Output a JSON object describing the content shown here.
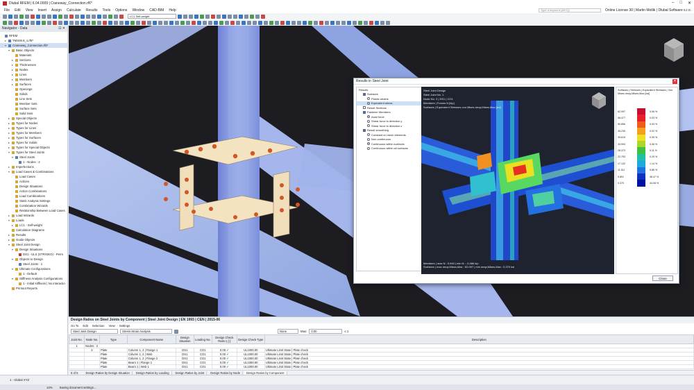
{
  "window": {
    "title": "Dlubal RFEM | 6.04.0009 | Craneway_Connection.rf6*"
  },
  "menu": [
    "File",
    "Edit",
    "View",
    "Insert",
    "Assign",
    "Calculate",
    "Results",
    "Tools",
    "Options",
    "Window",
    "CAD-BIM",
    "Help"
  ],
  "menu_right": {
    "search_placeholder": "Type a keyword (Alt+Q)",
    "license": "Online License 30 | Martin Motlik | Dlubal Software s.r.o."
  },
  "toolbar": {
    "load_case_code": "LC1",
    "load_case_name": "Self-weight"
  },
  "navigator": {
    "title": "Navigator - Data",
    "items": [
      {
        "label": "RFEM",
        "level": 0,
        "icon": "blue",
        "exp": ""
      },
      {
        "label": "TMS06.9_1.rf6*",
        "level": 1,
        "icon": "blue",
        "exp": "▸"
      },
      {
        "label": "Craneway_Connection.rf6*",
        "level": 1,
        "icon": "blue",
        "exp": "▾",
        "sel": true
      },
      {
        "label": "Basic Objects",
        "level": 2,
        "icon": "",
        "exp": "▾"
      },
      {
        "label": "Materials",
        "level": 3,
        "icon": "",
        "exp": ""
      },
      {
        "label": "Sections",
        "level": 3,
        "icon": "",
        "exp": "▸"
      },
      {
        "label": "Thicknesses",
        "level": 3,
        "icon": "",
        "exp": "▸"
      },
      {
        "label": "Nodes",
        "level": 3,
        "icon": "",
        "exp": "▸"
      },
      {
        "label": "Lines",
        "level": 3,
        "icon": "",
        "exp": "▸"
      },
      {
        "label": "Members",
        "level": 3,
        "icon": "",
        "exp": "▸"
      },
      {
        "label": "Surfaces",
        "level": 3,
        "icon": "",
        "exp": "▸"
      },
      {
        "label": "Openings",
        "level": 3,
        "icon": "",
        "exp": ""
      },
      {
        "label": "Solids",
        "level": 3,
        "icon": "",
        "exp": ""
      },
      {
        "label": "Line Sets",
        "level": 3,
        "icon": "",
        "exp": ""
      },
      {
        "label": "Member Sets",
        "level": 3,
        "icon": "",
        "exp": ""
      },
      {
        "label": "Surface Sets",
        "level": 3,
        "icon": "",
        "exp": ""
      },
      {
        "label": "Solid Sets",
        "level": 3,
        "icon": "",
        "exp": ""
      },
      {
        "label": "Special Objects",
        "level": 2,
        "icon": "",
        "exp": "▸"
      },
      {
        "label": "Types for Nodes",
        "level": 2,
        "icon": "",
        "exp": "▸"
      },
      {
        "label": "Types for Lines",
        "level": 2,
        "icon": "",
        "exp": "▸"
      },
      {
        "label": "Types for Members",
        "level": 2,
        "icon": "",
        "exp": "▸"
      },
      {
        "label": "Types for Surfaces",
        "level": 2,
        "icon": "",
        "exp": "▸"
      },
      {
        "label": "Types for Solids",
        "level": 2,
        "icon": "",
        "exp": "▸"
      },
      {
        "label": "Types for Special Objects",
        "level": 2,
        "icon": "",
        "exp": "▸"
      },
      {
        "label": "Types for Steel Joints",
        "level": 2,
        "icon": "",
        "exp": "▾"
      },
      {
        "label": "Steel Joints",
        "level": 3,
        "icon": "blue",
        "exp": "▾"
      },
      {
        "label": "1 - Nodes : 2",
        "level": 4,
        "icon": "blue",
        "exp": ""
      },
      {
        "label": "Imperfections",
        "level": 2,
        "icon": "",
        "exp": "▸"
      },
      {
        "label": "Load Cases & Combinations",
        "level": 2,
        "icon": "",
        "exp": "▾"
      },
      {
        "label": "Load Cases",
        "level": 3,
        "icon": "",
        "exp": ""
      },
      {
        "label": "Actions",
        "level": 3,
        "icon": "",
        "exp": ""
      },
      {
        "label": "Design Situations",
        "level": 3,
        "icon": "",
        "exp": ""
      },
      {
        "label": "Action Combinations",
        "level": 3,
        "icon": "",
        "exp": ""
      },
      {
        "label": "Load Combinations",
        "level": 3,
        "icon": "",
        "exp": ""
      },
      {
        "label": "Static Analysis Settings",
        "level": 3,
        "icon": "",
        "exp": ""
      },
      {
        "label": "Combination Wizards",
        "level": 3,
        "icon": "",
        "exp": ""
      },
      {
        "label": "Relationship Between Load Cases",
        "level": 3,
        "icon": "",
        "exp": ""
      },
      {
        "label": "Load Wizards",
        "level": 2,
        "icon": "",
        "exp": "▸"
      },
      {
        "label": "Loads",
        "level": 2,
        "icon": "",
        "exp": "▾"
      },
      {
        "label": "LC1 - Self-weight",
        "level": 3,
        "icon": "",
        "exp": "▸"
      },
      {
        "label": "Calculation Diagrams",
        "level": 2,
        "icon": "",
        "exp": ""
      },
      {
        "label": "Results",
        "level": 2,
        "icon": "",
        "exp": "▸"
      },
      {
        "label": "Guide Objects",
        "level": 2,
        "icon": "",
        "exp": "▸"
      },
      {
        "label": "Steel Joint Design",
        "level": 2,
        "icon": "",
        "exp": "▾"
      },
      {
        "label": "Design Situations",
        "level": 3,
        "icon": "",
        "exp": "▾"
      },
      {
        "label": "DS1 - ULS (STR/GEO) - Perm",
        "level": 4,
        "icon": "red",
        "exp": ""
      },
      {
        "label": "Objects to Design",
        "level": 3,
        "icon": "",
        "exp": "▾"
      },
      {
        "label": "Steel Joints : 1",
        "level": 4,
        "icon": "blue",
        "exp": ""
      },
      {
        "label": "Ultimate Configurations",
        "level": 3,
        "icon": "",
        "exp": "▾"
      },
      {
        "label": "1 - Default",
        "level": 4,
        "icon": "",
        "exp": ""
      },
      {
        "label": "Stiffness Analysis Configurations",
        "level": 3,
        "icon": "",
        "exp": "▾"
      },
      {
        "label": "1 - Initial stiffness | No interactio",
        "level": 4,
        "icon": "",
        "exp": ""
      },
      {
        "label": "Printout Reports",
        "level": 2,
        "icon": "",
        "exp": ""
      }
    ]
  },
  "dialog": {
    "title": "Results in Steel Joint",
    "tree": [
      {
        "label": "Results",
        "type": "none",
        "on": false,
        "indent": 0
      },
      {
        "label": "Surfaces",
        "type": "ck",
        "on": true,
        "indent": 1
      },
      {
        "label": "Plastic strains",
        "type": "rd",
        "on": false,
        "indent": 2
      },
      {
        "label": "Equivalent stress",
        "type": "rd",
        "on": true,
        "indent": 2,
        "sel": true
      },
      {
        "label": "Result Sections",
        "type": "ck",
        "on": false,
        "indent": 1
      },
      {
        "label": "Fastener Members",
        "type": "ck",
        "on": true,
        "indent": 1
      },
      {
        "label": "Axial force",
        "type": "rd",
        "on": true,
        "indent": 2
      },
      {
        "label": "Shear force in direction y",
        "type": "rd",
        "on": false,
        "indent": 2
      },
      {
        "label": "Shear force in direction z",
        "type": "rd",
        "on": false,
        "indent": 2
      },
      {
        "label": "Result smoothing",
        "type": "ck",
        "on": true,
        "indent": 1
      },
      {
        "label": "Constant on mesh elements",
        "type": "rd",
        "on": false,
        "indent": 2
      },
      {
        "label": "Non-continuous",
        "type": "rd",
        "on": false,
        "indent": 2
      },
      {
        "label": "Continuous within surfaces",
        "type": "rd",
        "on": true,
        "indent": 2
      },
      {
        "label": "Continuous within all surfaces",
        "type": "rd",
        "on": false,
        "indent": 2
      }
    ],
    "view_info": [
      "Steel Joint Design",
      "Steel Joint No. 1",
      "Node No. 2 | DS1 | CO1",
      "Members | Forces N [kip]",
      "Surfaces | Equivalent Stresses von Mises σeqv,Mises,Max [ksi]"
    ],
    "view_foot": [
      "Members | max N : 5.940 | min N : -0.486 kip",
      "Surfaces | max σeqv,Mises,Max : 62.097 | min σeqv,Mises,Max : 0.370 ksi"
    ],
    "legend_title": "Surfaces | Stresses | Equivalent Stresses | Von Mises σeqv,Mises,Max [ksi]",
    "legend": [
      {
        "val": "62.097",
        "color": "#c8102e",
        "pct": "0.06 %"
      },
      {
        "val": "56.477",
        "color": "#e8202a",
        "pct": "0.03 %"
      },
      {
        "val": "50.856",
        "color": "#f05a1a",
        "pct": "0.03 %"
      },
      {
        "val": "45.235",
        "color": "#f4a020",
        "pct": "0.02 %"
      },
      {
        "val": "39.615",
        "color": "#f0e020",
        "pct": "0.05 %"
      },
      {
        "val": "33.994",
        "color": "#a8d82a",
        "pct": "0.08 %"
      },
      {
        "val": "28.373",
        "color": "#40c040",
        "pct": "0.11 %"
      },
      {
        "val": "22.753",
        "color": "#20c0a0",
        "pct": "0.29 %"
      },
      {
        "val": "17.132",
        "color": "#20a8e0",
        "pct": "1.14 %"
      },
      {
        "val": "11.511",
        "color": "#2070e0",
        "pct": "5.86 %"
      },
      {
        "val": "5.891",
        "color": "#1030c0",
        "pct": "48.47 %"
      },
      {
        "val": "0.370",
        "color": "#0010a0",
        "pct": "44.08 %"
      }
    ],
    "close_label": "Close"
  },
  "table_panel": {
    "title": "Design Ratios on Steel Joints by Component | Steel Joint Design | EN 1993 | CEN | 2015-06",
    "menu": [
      "Go To",
      "Edit",
      "Selection",
      "View",
      "Settings"
    ],
    "design_select": "Steel Joint Design",
    "result_select": "Stress-Strain Analysis",
    "filter_select": "None",
    "max_label": "Max:",
    "max_value": "0.00",
    "ratio_label": "≤ 1",
    "headers": [
      "Joint No.",
      "Node No.",
      "Type",
      "Component Name",
      "Design Situation",
      "Loading No.",
      "Design Check Ratio η [-]",
      "Design Check Type",
      "Description"
    ],
    "group_row": {
      "joint": "1",
      "label": "Nodes : 2"
    },
    "rows": [
      {
        "node": "2",
        "type": "Plate",
        "name": "Column 1, 2 | Flange 1",
        "ds": "DS1",
        "load": "CO1",
        "ratio": "0.00",
        "check": "UL1000.00",
        "desc": "Ultimate Limit State | Plate check"
      },
      {
        "node": "",
        "type": "Plate",
        "name": "Column 1, 2 | Web",
        "ds": "DS1",
        "load": "CO1",
        "ratio": "0.00",
        "check": "UL1000.00",
        "desc": "Ultimate Limit State | Plate check"
      },
      {
        "node": "",
        "type": "Plate",
        "name": "Column 1, 2 | Flange 2",
        "ds": "DS1",
        "load": "CO1",
        "ratio": "0.00",
        "check": "UL1000.00",
        "desc": "Ultimate Limit State | Plate check"
      },
      {
        "node": "",
        "type": "Plate",
        "name": "Beam 1 | Flange 1",
        "ds": "DS1",
        "load": "CO1",
        "ratio": "0.00",
        "check": "UL1000.00",
        "desc": "Ultimate Limit State | Plate check"
      },
      {
        "node": "",
        "type": "Plate",
        "name": "Beam 1 | Web 1",
        "ds": "DS1",
        "load": "CO1",
        "ratio": "0.00",
        "check": "UL1000.00",
        "desc": "Ultimate Limit State | Plate check"
      }
    ],
    "pager": "5 of 5",
    "tabs": [
      "Design Ratios by Design Situation",
      "Design Ratios by Loading",
      "Design Ratios by Joint",
      "Design Ratios by Node",
      "Design Ratios by Component"
    ],
    "active_tab": 4
  },
  "bottom_left": {
    "view_label": "1 - Global XYZ"
  },
  "status": {
    "coord": "14%",
    "message": "Saving document settings..."
  }
}
